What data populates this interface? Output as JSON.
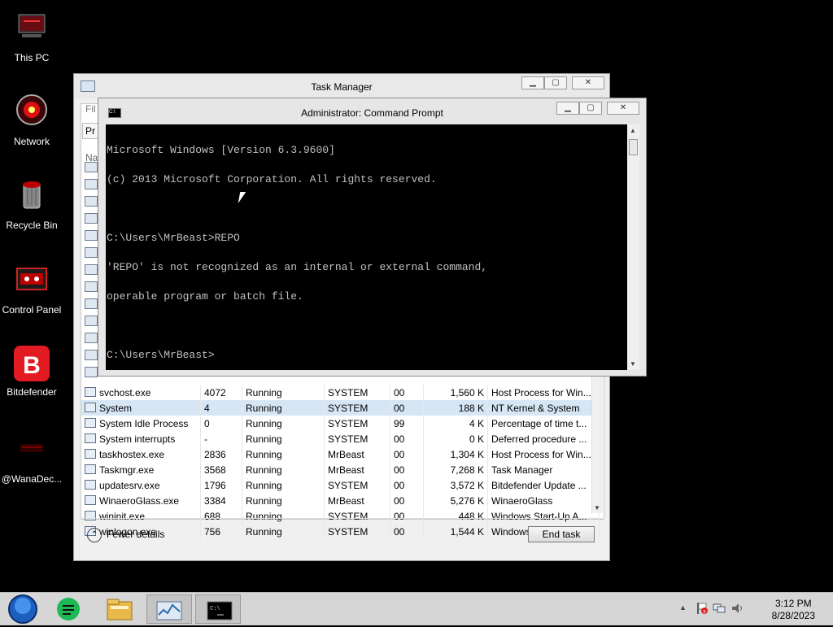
{
  "desktop": {
    "icons": [
      {
        "label": "This PC"
      },
      {
        "label": "Network"
      },
      {
        "label": "Recycle Bin"
      },
      {
        "label": "Control Panel"
      },
      {
        "label": "Bitdefender"
      },
      {
        "label": "@WanaDec..."
      }
    ]
  },
  "task_manager": {
    "title": "Task Manager",
    "menu_fragment": "Fil",
    "tab_fragment": "Pr",
    "column_fragment": "Na",
    "processes": [
      {
        "name": "svchost.exe",
        "pid": "4072",
        "status": "Running",
        "user": "SYSTEM",
        "cpu": "00",
        "memory": "1,560 K",
        "description": "Host Process for Win..."
      },
      {
        "name": "System",
        "pid": "4",
        "status": "Running",
        "user": "SYSTEM",
        "cpu": "00",
        "memory": "188 K",
        "description": "NT Kernel & System"
      },
      {
        "name": "System Idle Process",
        "pid": "0",
        "status": "Running",
        "user": "SYSTEM",
        "cpu": "99",
        "memory": "4 K",
        "description": "Percentage of time t..."
      },
      {
        "name": "System interrupts",
        "pid": "-",
        "status": "Running",
        "user": "SYSTEM",
        "cpu": "00",
        "memory": "0 K",
        "description": "Deferred procedure ..."
      },
      {
        "name": "taskhostex.exe",
        "pid": "2836",
        "status": "Running",
        "user": "MrBeast",
        "cpu": "00",
        "memory": "1,304 K",
        "description": "Host Process for Win..."
      },
      {
        "name": "Taskmgr.exe",
        "pid": "3568",
        "status": "Running",
        "user": "MrBeast",
        "cpu": "00",
        "memory": "7,268 K",
        "description": "Task Manager"
      },
      {
        "name": "updatesrv.exe",
        "pid": "1796",
        "status": "Running",
        "user": "SYSTEM",
        "cpu": "00",
        "memory": "3,572 K",
        "description": "Bitdefender Update ..."
      },
      {
        "name": "WinaeroGlass.exe",
        "pid": "3384",
        "status": "Running",
        "user": "MrBeast",
        "cpu": "00",
        "memory": "5,276 K",
        "description": "WinaeroGlass"
      },
      {
        "name": "wininit.exe",
        "pid": "688",
        "status": "Running",
        "user": "SYSTEM",
        "cpu": "00",
        "memory": "448 K",
        "description": "Windows Start-Up A..."
      },
      {
        "name": "winlogon.exe",
        "pid": "756",
        "status": "Running",
        "user": "SYSTEM",
        "cpu": "00",
        "memory": "1,544 K",
        "description": "Windows Logon Ap..."
      }
    ],
    "fewer_details": "Fewer details",
    "end_task": "End task"
  },
  "cmd": {
    "title": "Administrator: Command Prompt",
    "lines": [
      "Microsoft Windows [Version 6.3.9600]",
      "(c) 2013 Microsoft Corporation. All rights reserved.",
      "",
      "C:\\Users\\MrBeast>REPO",
      "'REPO' is not recognized as an internal or external command,",
      "operable program or batch file.",
      "",
      "C:\\Users\\MrBeast>"
    ]
  },
  "taskbar": {
    "buttons": [
      {
        "icon": "start-orb-icon"
      },
      {
        "icon": "notes-app-icon"
      },
      {
        "icon": "file-explorer-icon"
      },
      {
        "icon": "task-manager-icon"
      },
      {
        "icon": "command-prompt-icon"
      }
    ],
    "clock": {
      "time": "3:12 PM",
      "date": "8/28/2023"
    }
  }
}
